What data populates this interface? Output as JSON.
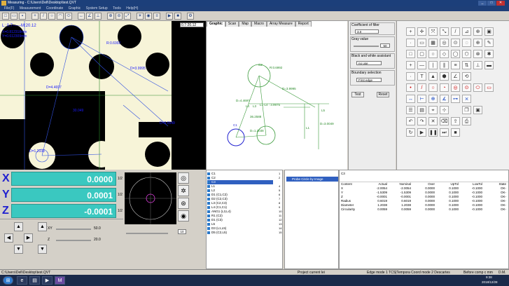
{
  "window": {
    "title": "Measuring - C:\\Users\\Dell\\Desktop\\test.QVT"
  },
  "menu": [
    "File(F)",
    "Measurement",
    "Coordinate",
    "Graphic",
    "System Setup",
    "Tools",
    "Help(H)"
  ],
  "camera": {
    "length_readout": "L: 0.7------M:20.12",
    "x_readout": "X=0.812318mm",
    "y_readout": "Y=0.612309mm",
    "zoom_select": "0.7-20.12",
    "dim_r": "R:0.6992",
    "dim_d1": "D=3.9995",
    "dim_d2": "D=4.4697",
    "dim_d3": "D=3.0049",
    "dim_d4": "D=1.2038",
    "dim_1": "30.049"
  },
  "graphic": {
    "tabs": [
      "Graphic",
      "Scan",
      "Map",
      "Macro",
      "Array Measure",
      "Report"
    ],
    "labels": {
      "c2": "C2",
      "c1": "C1",
      "r": "R:0.6992",
      "d1": "D=3.9995",
      "d2": "D=4.4697",
      "l4": "L4",
      "l3": "L3",
      "l5": "L5",
      "l1": "L1",
      "d3": "D=3.0049",
      "d4": "D=1.2038",
      "ang": "36.2588",
      "len": "L1-L4 : 3.9975"
    }
  },
  "settings": {
    "coefficient_label": "Coefficient of filter",
    "coefficient_value": "3.0",
    "gray_label": "Gray value",
    "gray_value": "50",
    "bw_label": "Black and white assistant",
    "bw_value": "no use",
    "boundary_label": "Boundary selection",
    "boundary_value": "First edge",
    "test_button": "Test",
    "reset_button": "Reset"
  },
  "dro": {
    "x": {
      "label": "X",
      "value": "0.0000",
      "unit": "1/2"
    },
    "y": {
      "label": "Y",
      "value": "0.0001",
      "unit": "1/2"
    },
    "z": {
      "label": "Z",
      "value": "-0.0001",
      "unit": "1/2"
    }
  },
  "jog": {
    "xy_label": "XY",
    "xy_speed": "50.0",
    "z_label": "Z",
    "z_speed": "20.0"
  },
  "preview": {
    "spin_value": "10"
  },
  "shape_list": [
    {
      "name": "C1",
      "num": "1"
    },
    {
      "name": "C2",
      "num": "2"
    },
    {
      "name": "C3",
      "num": "3"
    },
    {
      "name": "L1",
      "num": "4"
    },
    {
      "name": "L2",
      "num": "5"
    },
    {
      "name": "D1 (C1,C2)",
      "num": "6"
    },
    {
      "name": "D2 (C2,C3)",
      "num": "7"
    },
    {
      "name": "L3 (C2,C3)",
      "num": "8"
    },
    {
      "name": "L4 (C1,C1)",
      "num": "9"
    },
    {
      "name": "ANG1 (L3,L4)",
      "num": "10"
    },
    {
      "name": "R1 (C2)",
      "num": "11"
    },
    {
      "name": "D1 (C3)",
      "num": "12"
    },
    {
      "name": "L5",
      "num": "13"
    },
    {
      "name": "D3 (L1,L5)",
      "num": "14"
    },
    {
      "name": "D5 (C2,L5)",
      "num": "15"
    }
  ],
  "probe": {
    "item": "Probe Circle by Image"
  },
  "results": {
    "title": "C3",
    "headers": [
      "Content",
      "Actual",
      "Nominal",
      "Over",
      "UpTol",
      "LowTol",
      "State"
    ],
    "rows": [
      [
        "X",
        "-2.0054",
        "-2.0054",
        "0.0000",
        "0.1000",
        "-0.1000",
        "OK-"
      ],
      [
        "Y",
        "-1.5309",
        "-1.5309",
        "0.0000",
        "0.1000",
        "-0.1000",
        "OK-"
      ],
      [
        "Z",
        "-0.0001",
        "-0.0001",
        "0.0000",
        "0.1000",
        "-0.1000",
        "OK-"
      ],
      [
        "Radius",
        "0.6019",
        "0.6019",
        "0.0000",
        "0.1000",
        "-0.1000",
        "OK-"
      ],
      [
        "Diameter",
        "1.2038",
        "1.2038",
        "0.0000",
        "0.1000",
        "-0.1000",
        "OK-"
      ],
      [
        "Circularity",
        "0.0059",
        "0.0059",
        "0.0000",
        "0.1000",
        "-0.1000",
        "OK-"
      ]
    ]
  },
  "status": {
    "path": "C:\\Users\\Dell\\Desktop\\test.QVT",
    "project": "Project current lei",
    "edge": "Edge mode 1 TCS|Tempora Coord mode 2 Descartes",
    "before": "Before comp c mm",
    "dm": "D.M."
  },
  "taskbar": {
    "time": "9:38",
    "date": "2018/12/28"
  }
}
